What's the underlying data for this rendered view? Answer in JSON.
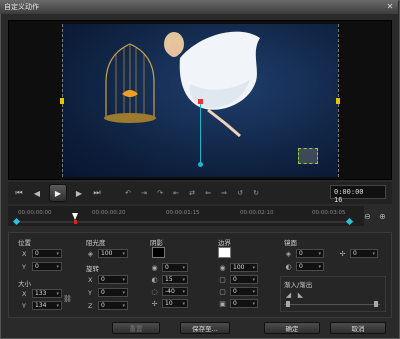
{
  "window": {
    "title": "自定义动作",
    "close": "✕"
  },
  "timecode": "0:00:00",
  "timecode_frames": "16",
  "timeline": {
    "ticks": [
      "00:00:00:00",
      "00:00:00:20",
      "00:00:01:15",
      "00:00:02:10",
      "00:00:03:05"
    ]
  },
  "position": {
    "title": "位置",
    "x_label": "X",
    "x": "0",
    "y_label": "Y",
    "y": "0"
  },
  "size": {
    "title": "大小",
    "x_label": "X",
    "x": "133",
    "y_label": "Y",
    "y": "134"
  },
  "opacity": {
    "title": "阻光度",
    "value": "100"
  },
  "rotation": {
    "title": "旋转",
    "x_label": "X",
    "x": "0",
    "y_label": "Y",
    "y": "0",
    "z_label": "Z",
    "z": "0"
  },
  "shadow": {
    "title": "阴影",
    "color": "#000000",
    "v1": "0",
    "v2": "15",
    "v3": "-40",
    "v4": "10"
  },
  "border": {
    "title": "边界",
    "color": "#ffffff",
    "v1": "100",
    "v2": "0",
    "v3": "0",
    "v4": "0"
  },
  "mirror": {
    "title": "镜面",
    "v1": "0",
    "v2": "0",
    "v3": "0"
  },
  "fade": {
    "title": "渐入/渐出"
  },
  "buttons": {
    "reset": "重置",
    "save_as": "保存至...",
    "ok": "确定",
    "cancel": "取消"
  },
  "colors": {
    "accent": "#1fb5c8",
    "keyframe": "#2ac0e0",
    "handle": "#e8c400"
  }
}
